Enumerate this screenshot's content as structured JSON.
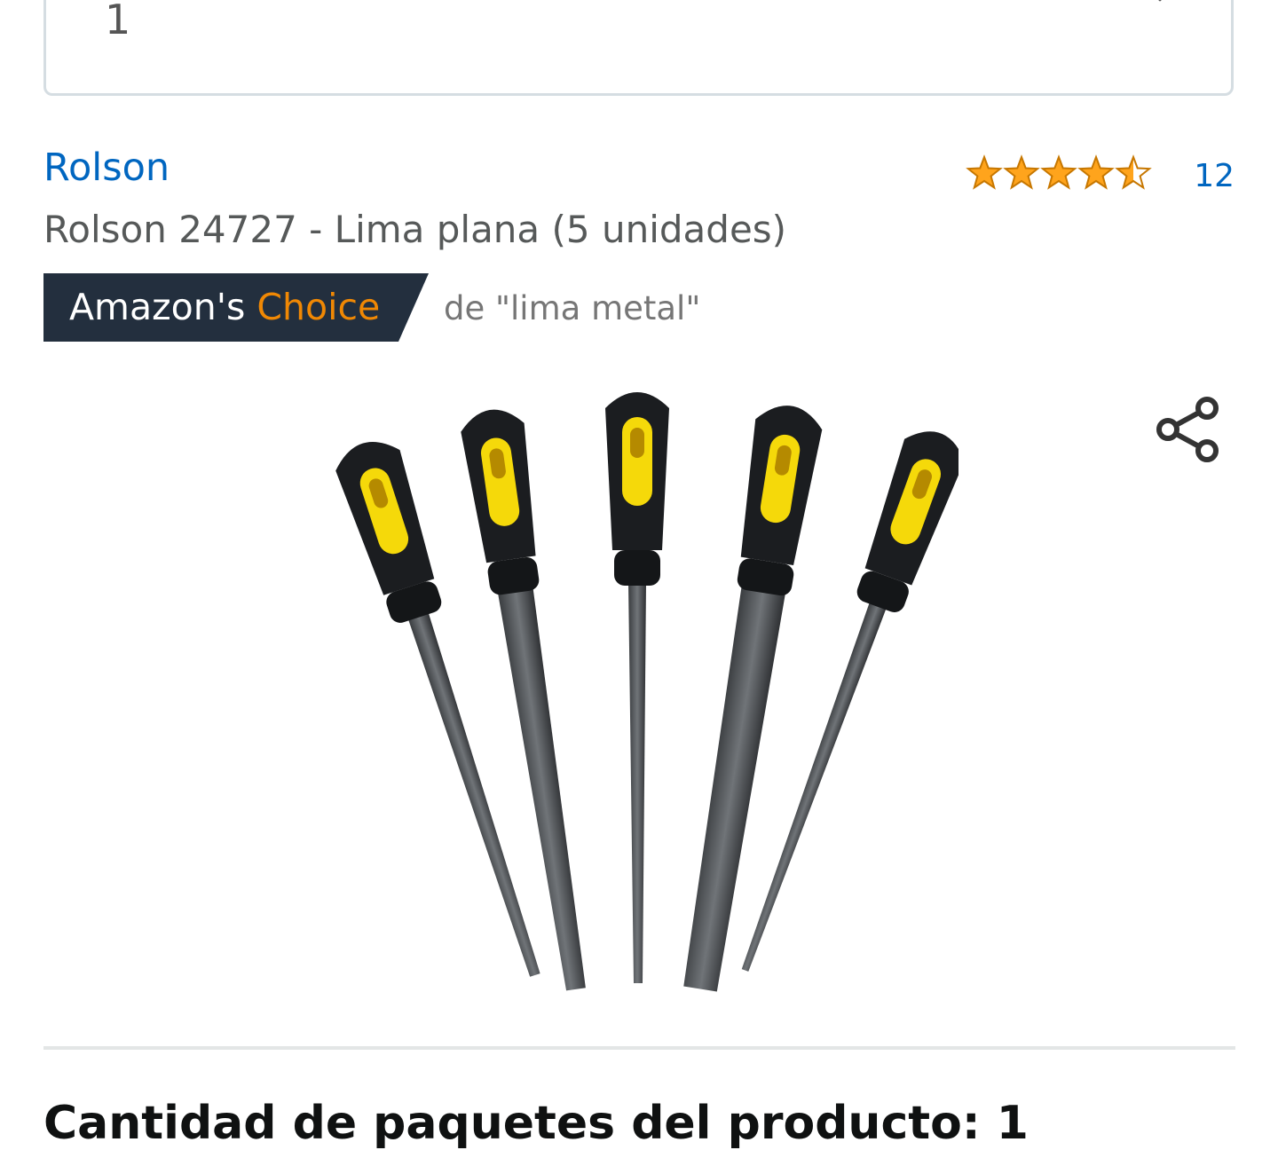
{
  "quantity_selector": {
    "value": "1"
  },
  "product": {
    "brand": "Rolson",
    "title": "Rolson 24727 - Lima plana (5 unidades)",
    "rating": 4.5,
    "rating_max": 5,
    "review_count": "12"
  },
  "badge": {
    "prefix": "Amazon's ",
    "highlight": "Choice",
    "keyword": "de \"lima metal\"",
    "colors": {
      "background": "#232f3e",
      "highlight": "#f08804"
    }
  },
  "icons": {
    "share": "share-icon",
    "dropdown": "chevron-down-icon",
    "rating": "star-icon"
  },
  "colors": {
    "link": "#0066c0",
    "star": "#ffa41c",
    "handle_yellow": "#f5d90a"
  },
  "next_section": {
    "heading": "Cantidad de paquetes del producto: 1"
  }
}
